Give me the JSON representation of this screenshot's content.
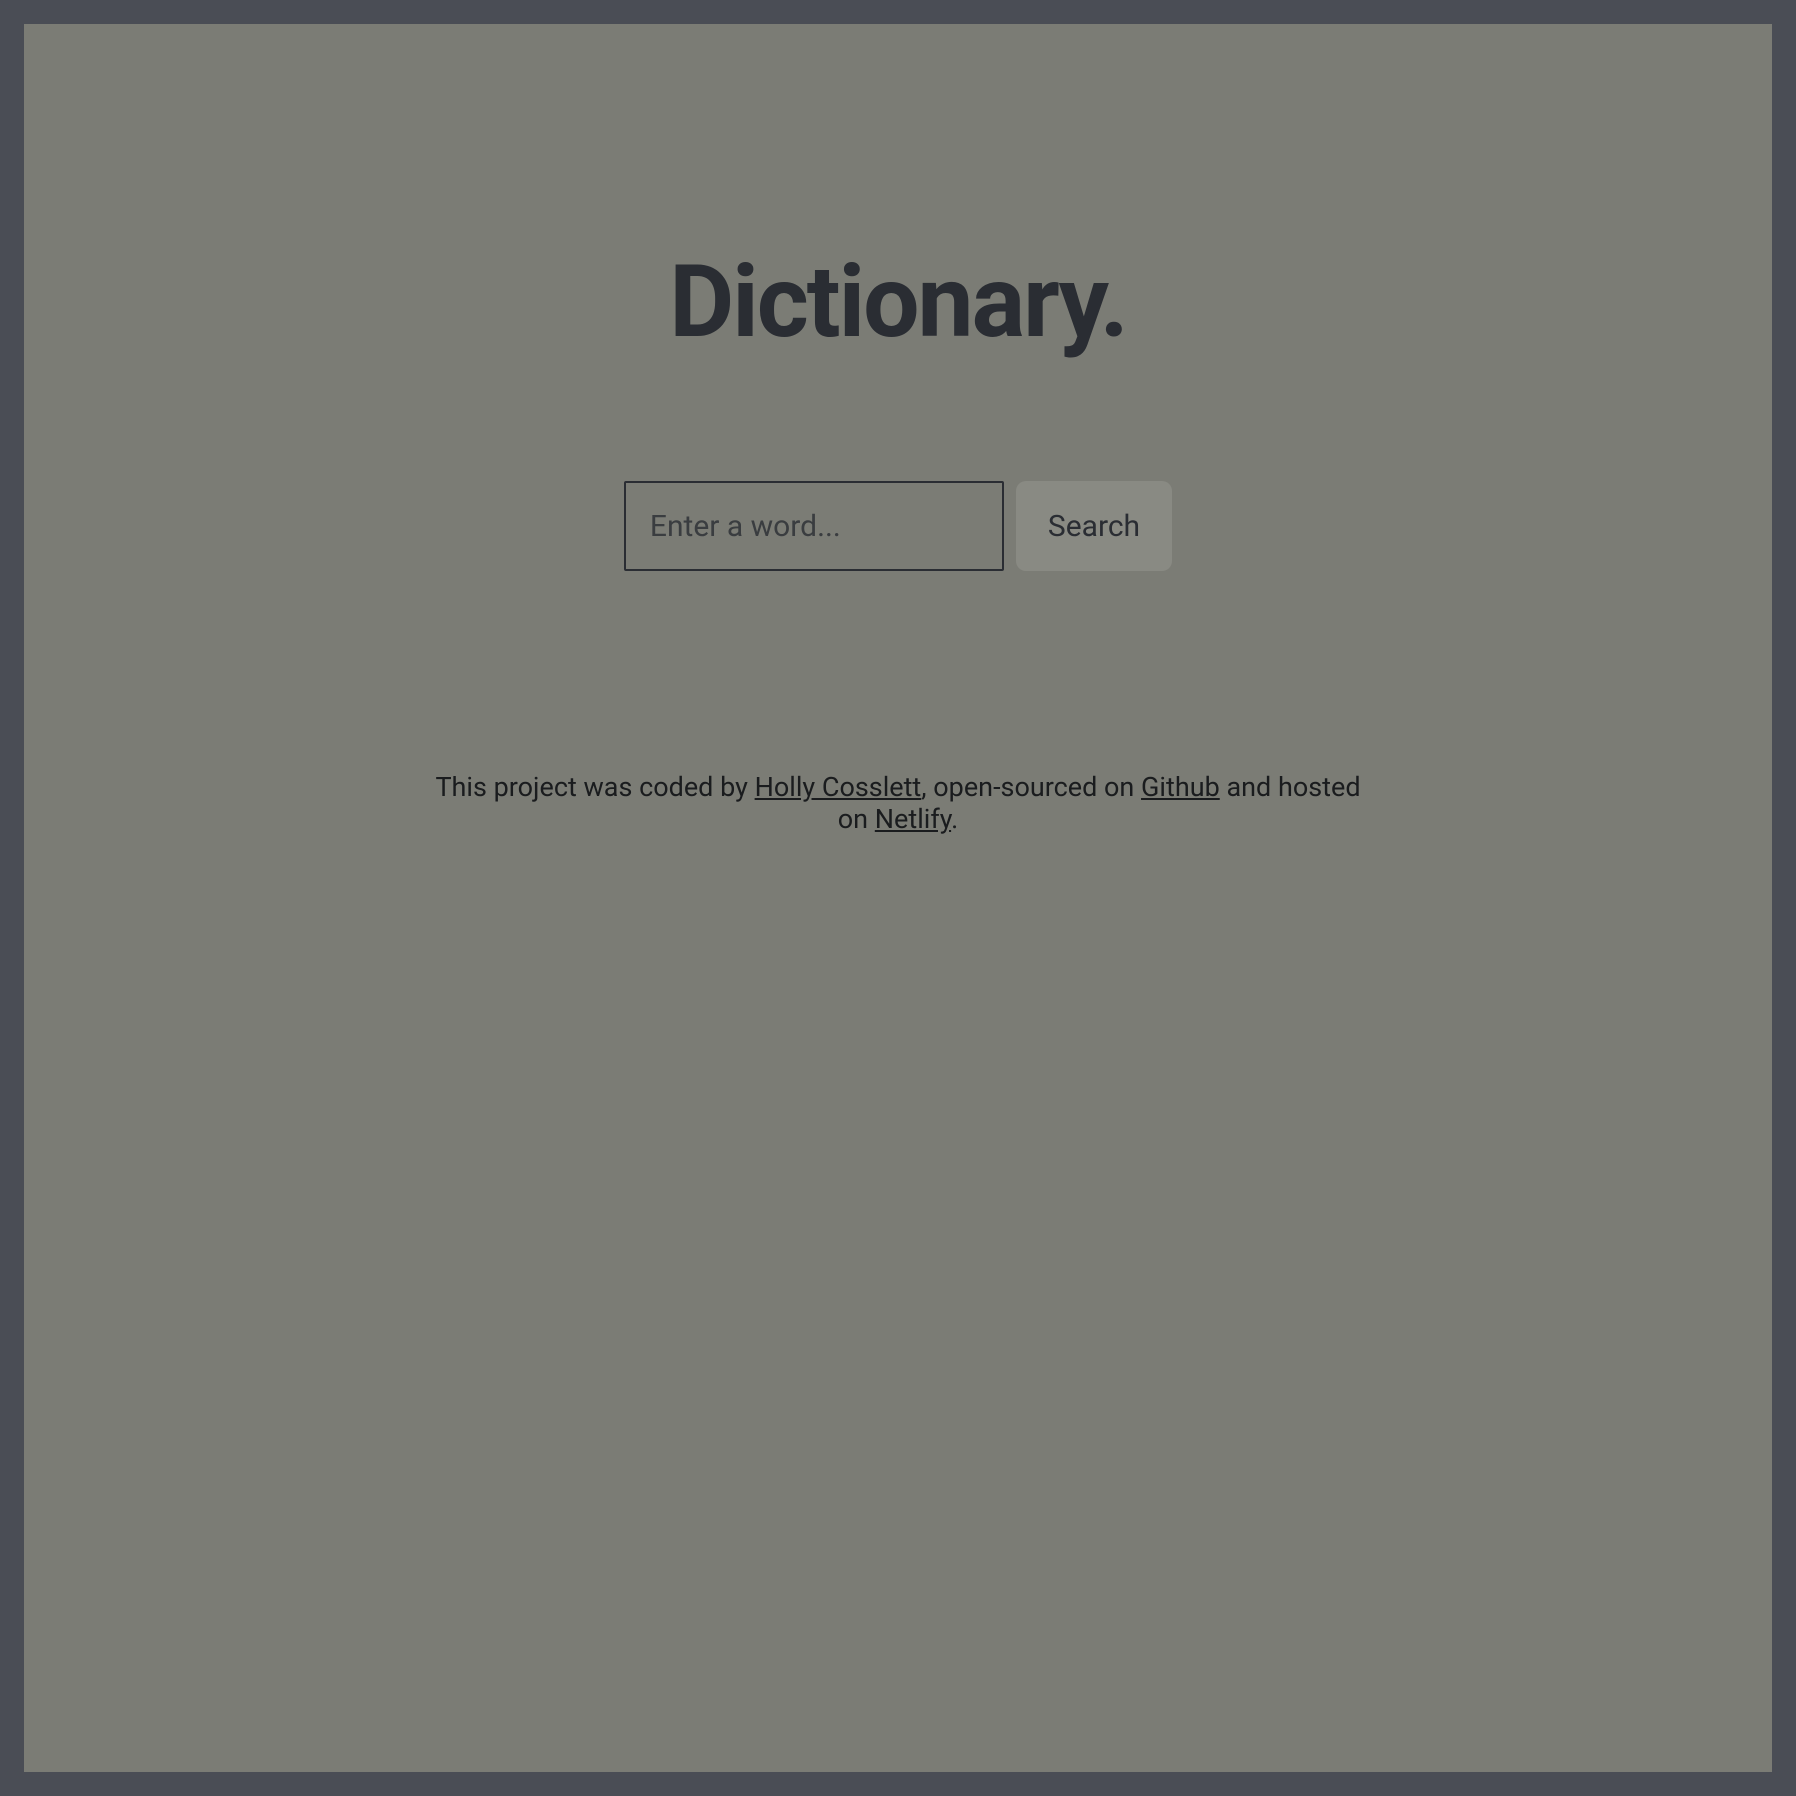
{
  "header": {
    "title": "Dictionary."
  },
  "search": {
    "placeholder": "Enter a word...",
    "button_label": "Search"
  },
  "footer": {
    "prefix": "This project was coded by ",
    "author": "Holly Cosslett",
    "middle1": ", open-sourced on ",
    "github_label": "Github",
    "middle2": " and hosted on ",
    "netlify_label": "Netlify",
    "suffix": "."
  }
}
